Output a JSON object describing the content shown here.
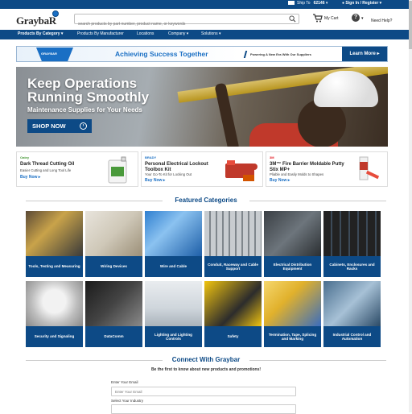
{
  "topbar": {
    "ship_label": "Ship To",
    "ship_zip": "62146",
    "sign_in": "Sign In / Register"
  },
  "header": {
    "logo": "GraybaR",
    "search_placeholder": "search products by part number, product name, or keywords",
    "cart_label": "My Cart",
    "help_label": "Need Help?"
  },
  "nav": {
    "items": [
      {
        "label": "Products By Category ▾"
      },
      {
        "label": "Products By Manufacturer"
      },
      {
        "label": "Locations"
      },
      {
        "label": "Company ▾"
      },
      {
        "label": "Solutions ▾"
      }
    ]
  },
  "promo": {
    "badge": "GRAYBAR",
    "title": "Achieving Success Together",
    "subtitle": "Powering A New Era With Our Suppliers",
    "cta": "Learn More ▸"
  },
  "hero": {
    "headline_1": "Keep Operations",
    "headline_2": "Running Smoothly",
    "subhead": "Maintenance Supplies for Your Needs",
    "cta": "SHOP NOW",
    "cta_arrow": "›"
  },
  "products": [
    {
      "brand": "Oatey",
      "name": "Dark Thread Cutting Oil",
      "desc": "Easier Cutting and Long Tool Life",
      "buy": "Buy Now ▸",
      "brand_color": "#4a9a3b"
    },
    {
      "brand": "BRADY",
      "name": "Personal Electrical Lockout Toolbox Kit",
      "desc": "Your Go-To Kit for Locking Out",
      "buy": "Buy Now ▸",
      "brand_color": "#1a6fc4"
    },
    {
      "brand": "3M",
      "name": "3M™ Fire Barrier Moldable Putty Stix MP+",
      "desc": "Pliable and Easily Molds to Shapes",
      "buy": "Buy Now ▸",
      "brand_color": "#e31b23"
    }
  ],
  "featured": {
    "title": "Featured Categories",
    "categories": [
      {
        "label": "Tools, Testing and Measuring"
      },
      {
        "label": "Wiring Devices"
      },
      {
        "label": "Wire and Cable"
      },
      {
        "label": "Conduit, Raceway and Cable Support"
      },
      {
        "label": "Electrical Distribution Equipment"
      },
      {
        "label": "Cabinets, Enclosures and Racks"
      },
      {
        "label": "Security and Signaling"
      },
      {
        "label": "DataComm"
      },
      {
        "label": "Lighting and Lighting Controls"
      },
      {
        "label": "Safety"
      },
      {
        "label": "Termination, Tape, Splicing and Marking"
      },
      {
        "label": "Industrial Control and Automation"
      }
    ]
  },
  "connect": {
    "title": "Connect With Graybar",
    "subtitle": "Be the first to know about new products and promotions!",
    "email_label": "Enter Your Email",
    "email_placeholder": "Enter Your Email",
    "industry_label": "Select Your Industry"
  }
}
